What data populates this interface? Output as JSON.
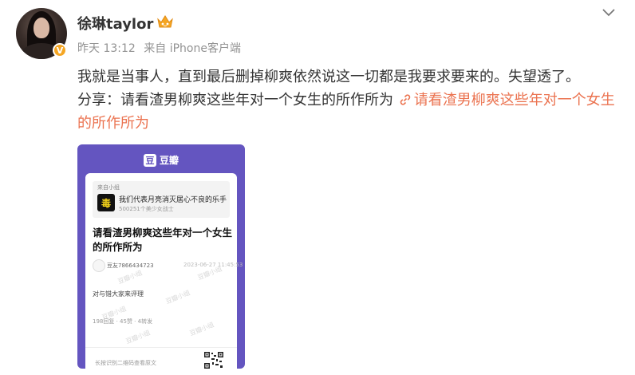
{
  "post": {
    "author": {
      "name": "徐琳taylor",
      "verified_badge": "V",
      "vip_icon": "crown-icon"
    },
    "meta": {
      "time": "昨天 13:12",
      "source": "来自 iPhone客户端"
    },
    "content": {
      "line1": "我就是当事人，直到最后删掉柳爽依然说这一切都是我要求要来的。失望透了。",
      "share_prefix": "分享：请看渣男柳爽这些年对一个女生的所作所为",
      "link_text": "请看渣男柳爽这些年对一个女生的所作所为"
    },
    "card": {
      "brand": "豆瓣",
      "brand_logo": "豆",
      "group_from": "来自小组",
      "group_logo": "毒",
      "group_name": "我们代表月亮消灭居心不良的乐手",
      "group_sub": "500251个美少女战士",
      "title": "请看渣男柳爽这些年对一个女生的所作所为",
      "author": "豆友7866434723",
      "time": "2023-06-27 11:45:53",
      "body": "对与错大家来评理",
      "stats": "198回复 · 45赞 · 4转发",
      "watermark": "豆瓣小组",
      "footer": "长按识别二维码查看原文"
    }
  },
  "colors": {
    "link": "#eb7350",
    "meta": "#939393",
    "card_bg": "#6455c0",
    "badge": "#f5a623"
  }
}
